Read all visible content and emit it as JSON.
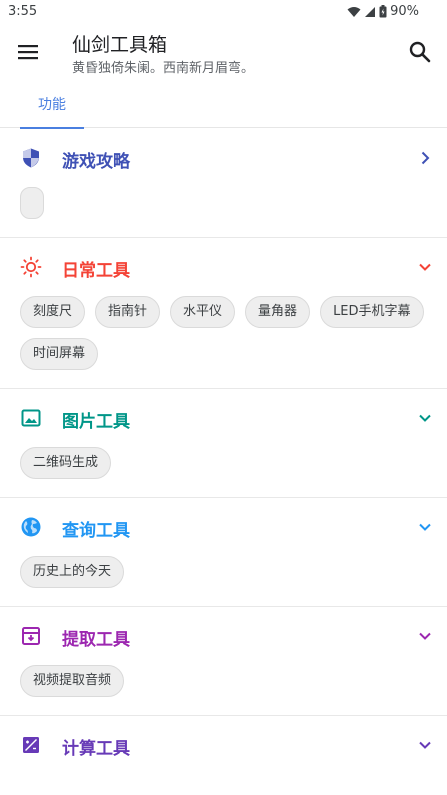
{
  "status": {
    "time": "3:55",
    "battery": "90%"
  },
  "app": {
    "title": "仙剑工具箱",
    "subtitle": "黄昏独倚朱阑。西南新月眉弯。"
  },
  "tabs": [
    {
      "label": "功能"
    }
  ],
  "sections": [
    {
      "title": "游戏攻略",
      "color": "#3f51b5",
      "icon": "shield-icon",
      "expanded": false,
      "chips": []
    },
    {
      "title": "日常工具",
      "color": "#f44336",
      "icon": "sun-icon",
      "expanded": true,
      "chips": [
        "刻度尺",
        "指南针",
        "水平仪",
        "量角器",
        "LED手机字幕",
        "时间屏幕"
      ]
    },
    {
      "title": "图片工具",
      "color": "#009688",
      "icon": "image-icon",
      "expanded": true,
      "chips": [
        "二维码生成"
      ]
    },
    {
      "title": "查询工具",
      "color": "#2196f3",
      "icon": "globe-icon",
      "expanded": true,
      "chips": [
        "历史上的今天"
      ]
    },
    {
      "title": "提取工具",
      "color": "#9c27b0",
      "icon": "archive-icon",
      "expanded": true,
      "chips": [
        "视频提取音频"
      ]
    },
    {
      "title": "计算工具",
      "color": "#673ab7",
      "icon": "calculator-icon",
      "expanded": true,
      "chips": []
    }
  ]
}
